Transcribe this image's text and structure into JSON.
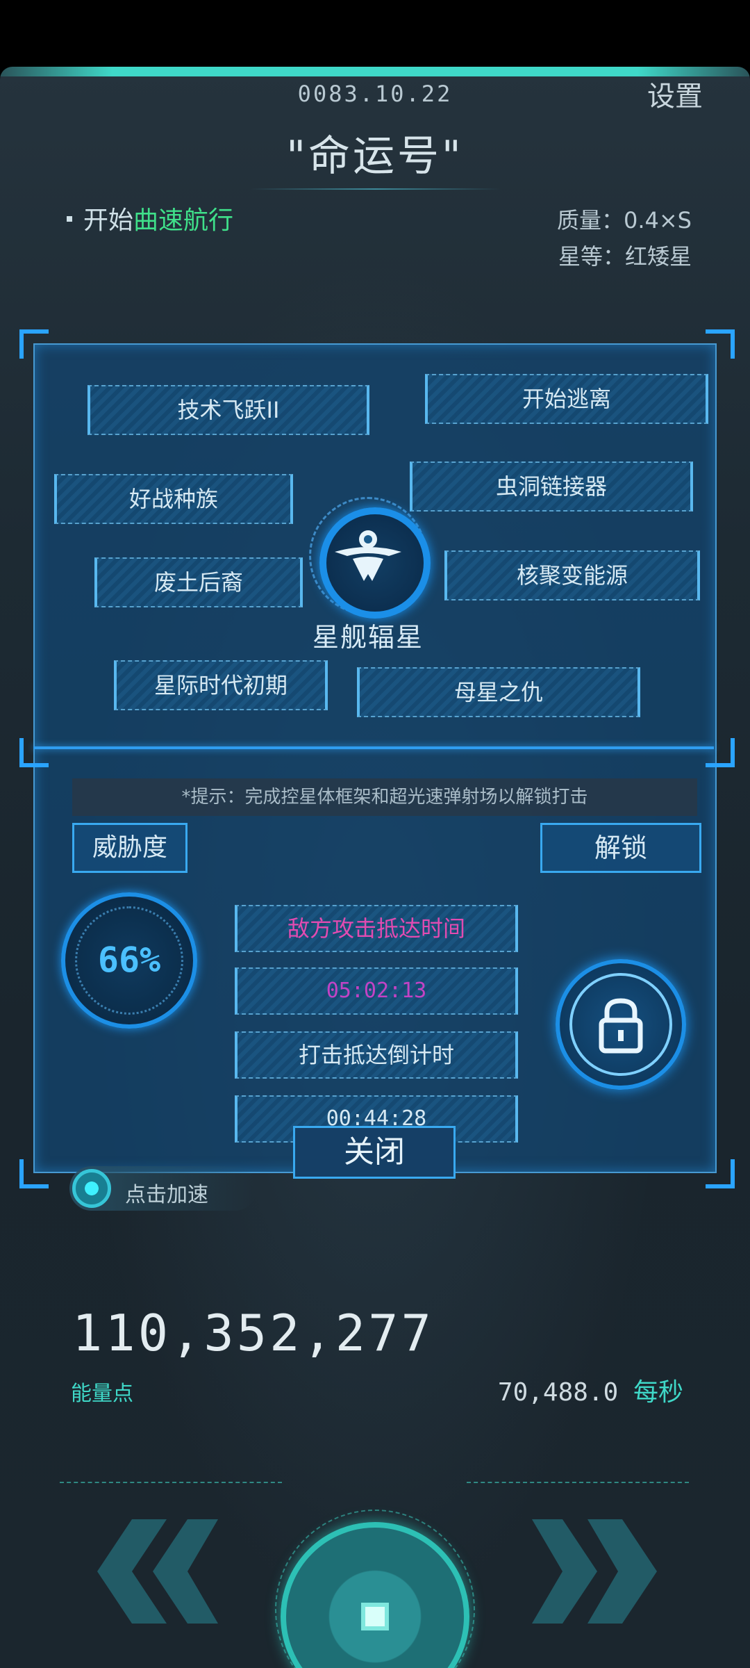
{
  "header": {
    "date": "0083.10.22",
    "settings_label": "设置",
    "ship_name": "\"命运号\""
  },
  "status": {
    "prefix": "开始",
    "accent": "曲速航行",
    "mass_label": "质量：0.4×S",
    "star_class_label": "星等：红矮星"
  },
  "tech_tree": {
    "hub_label": "星舰辐星",
    "nodes": [
      "技术飞跃II",
      "开始逃离",
      "好战种族",
      "虫洞链接器",
      "废土后裔",
      "核聚变能源",
      "星际时代初期",
      "母星之仇"
    ]
  },
  "attack": {
    "hint": "*提示：完成控星体框架和超光速弹射场以解锁打击",
    "threat_label": "威胁度",
    "threat_value": "66%",
    "unlock_label": "解锁",
    "enemy_arrival_label": "敌方攻击抵达时间",
    "enemy_arrival_time": "05:02:13",
    "strike_countdown_label": "打击抵达倒计时",
    "strike_countdown_time": "00:44:28",
    "close_label": "关闭"
  },
  "accelerate_label": "点击加速",
  "energy": {
    "total": "110,352,277",
    "label": "能量点",
    "rate_value": "70,488.0",
    "rate_unit": "每秒"
  },
  "colors": {
    "accent_green": "#3fe08a",
    "teal": "#3fd8c8",
    "panel_blue": "#1c8fe6",
    "enemy_pink": "#e24bb1"
  },
  "icons": [
    "lock-icon",
    "ship-emblem-icon",
    "accelerate-icon",
    "left-arrow-icon",
    "right-arrow-icon",
    "main-action-icon"
  ]
}
